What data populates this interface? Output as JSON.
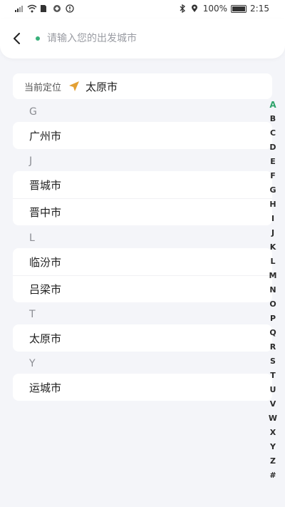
{
  "status_bar": {
    "battery_text": "100%",
    "time": "2:15"
  },
  "header": {
    "search_placeholder": "请输入您的出发城市"
  },
  "current_location": {
    "label": "当前定位",
    "city": "太原市"
  },
  "sections": [
    {
      "letter": "G",
      "cities": [
        "广州市"
      ]
    },
    {
      "letter": "J",
      "cities": [
        "晋城市",
        "晋中市"
      ]
    },
    {
      "letter": "L",
      "cities": [
        "临汾市",
        "吕梁市"
      ]
    },
    {
      "letter": "T",
      "cities": [
        "太原市"
      ]
    },
    {
      "letter": "Y",
      "cities": [
        "运城市"
      ]
    }
  ],
  "alphabet": [
    "A",
    "B",
    "C",
    "D",
    "E",
    "F",
    "G",
    "H",
    "I",
    "J",
    "K",
    "L",
    "M",
    "N",
    "O",
    "P",
    "Q",
    "R",
    "S",
    "T",
    "U",
    "V",
    "W",
    "X",
    "Y",
    "Z",
    "#"
  ],
  "colors": {
    "accent": "#2ea36a",
    "nav_arrow": "#e3a034"
  }
}
